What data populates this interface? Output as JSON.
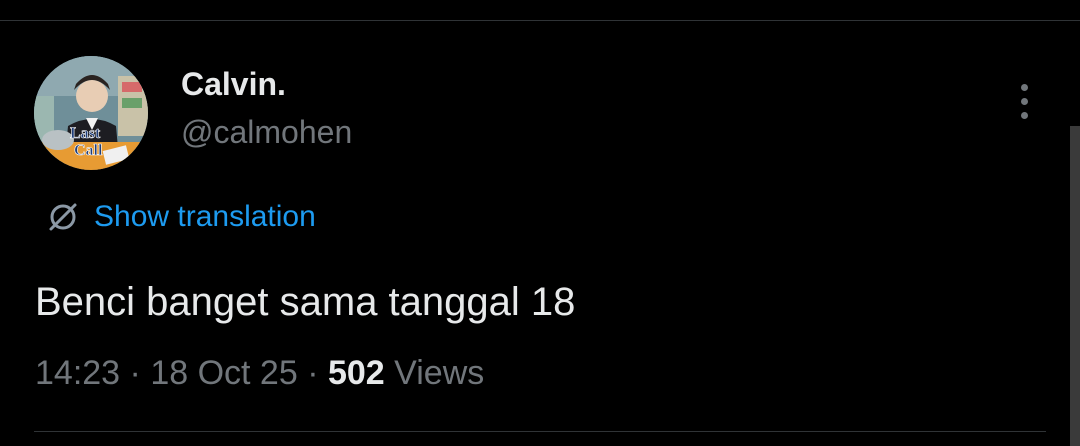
{
  "author": {
    "display_name": "Calvin.",
    "handle": "@calmohen",
    "avatar_caption_line1": "Last",
    "avatar_caption_line2": "Call"
  },
  "actions": {
    "translate_label": "Show translation",
    "translate_icon": "globe-slash-icon",
    "more_icon": "more-vertical-icon"
  },
  "tweet": {
    "text": "Benci banget sama tanggal 18",
    "time": "14:23",
    "separator": "·",
    "date": "18 Oct 25",
    "views_count": "502",
    "views_label": "Views"
  },
  "colors": {
    "background": "#000000",
    "text_primary": "#e7e9ea",
    "text_secondary": "#71767b",
    "accent": "#1d9bf0",
    "divider": "#2f3336"
  }
}
